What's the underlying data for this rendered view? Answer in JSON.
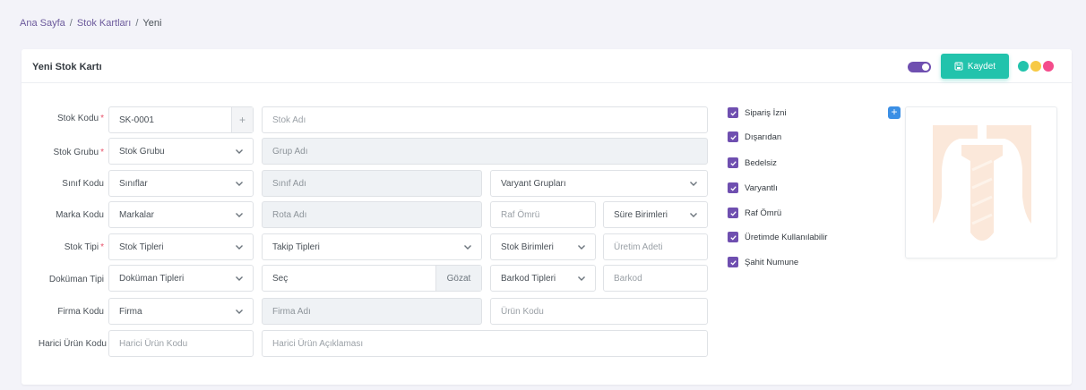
{
  "breadcrumb": {
    "home": "Ana Sayfa",
    "section": "Stok Kartları",
    "current": "Yeni"
  },
  "card": {
    "title": "Yeni Stok Kartı",
    "save_label": "Kaydet"
  },
  "colors": {
    "accent": "#6f4fb0",
    "save": "#22c3ac",
    "dot1": "#22c3ac",
    "dot2": "#f7c945",
    "dot3": "#f44c8b"
  },
  "labels": {
    "stok_kodu": "Stok Kodu",
    "stok_grubu": "Stok Grubu",
    "sinif_kodu": "Sınıf Kodu",
    "marka_kodu": "Marka Kodu",
    "stok_tipi": "Stok Tipi",
    "dokuman_tipi": "Doküman Tipi",
    "firma_kodu": "Firma Kodu",
    "harici_urun_kodu": "Harici Ürün Kodu",
    "required_mark": "*"
  },
  "fields": {
    "stok_kodu_value": "SK-0001",
    "stok_kodu_addon": "+",
    "stok_adi": "Stok Adı",
    "stok_grubu_select": "Stok Grubu",
    "grup_adi": "Grup Adı",
    "siniflar_select": "Sınıflar",
    "sinif_adi": "Sınıf Adı",
    "varyant_gruplari": "Varyant Grupları",
    "markalar_select": "Markalar",
    "rota_adi": "Rota Adı",
    "raf_omru": "Raf Ömrü",
    "sure_birimleri": "Süre Birimleri",
    "stok_tipleri": "Stok Tipleri",
    "takip_tipleri": "Takip Tipleri",
    "stok_birimleri": "Stok Birimleri",
    "uretim_adeti": "Üretim Adeti",
    "dokuman_tipleri": "Doküman Tipleri",
    "sec": "Seç",
    "gozat": "Gözat",
    "barkod_tipleri": "Barkod Tipleri",
    "barkod": "Barkod",
    "firma_select": "Firma",
    "firma_adi": "Firma Adı",
    "urun_kodu": "Ürün Kodu",
    "harici_urun_kodu": "Harici Ürün Kodu",
    "harici_urun_aciklamasi": "Harici Ürün Açıklaması"
  },
  "checks": [
    {
      "label": "Sipariş İzni",
      "checked": true
    },
    {
      "label": "Dışarıdan",
      "checked": true
    },
    {
      "label": "Bedelsiz",
      "checked": true
    },
    {
      "label": "Varyantlı",
      "checked": true
    },
    {
      "label": "Raf Ömrü",
      "checked": true
    },
    {
      "label": "Üretimde Kullanılabilir",
      "checked": true
    },
    {
      "label": "Şahit Numune",
      "checked": true
    }
  ],
  "image": {
    "add_label": "+"
  }
}
